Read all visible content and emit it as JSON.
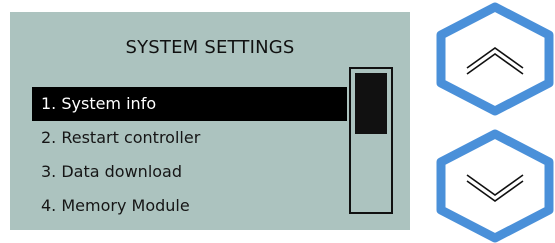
{
  "screen": {
    "title": "SYSTEM SETTINGS",
    "menu_items": [
      {
        "label": "1. System info",
        "selected": true
      },
      {
        "label": "2. Restart controller",
        "selected": false
      },
      {
        "label": "3. Data download",
        "selected": false
      },
      {
        "label": "4. Memory Module",
        "selected": false
      }
    ],
    "background_color": "#acc3bf",
    "selection_color": "#000000"
  },
  "scrollbar": {
    "position_fraction": 0.0,
    "visible_fraction": 0.45
  },
  "controls": {
    "accent_color": "#4a90d9",
    "up_icon": "chevron-up-icon",
    "down_icon": "chevron-down-icon"
  }
}
